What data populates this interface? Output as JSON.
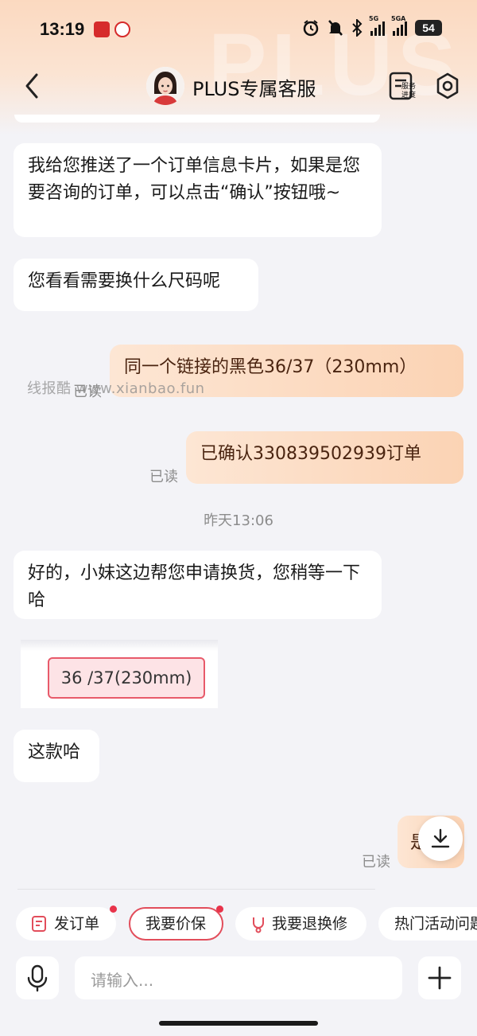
{
  "status_bar": {
    "time": "13:19",
    "signal_1_label": "5G",
    "signal_2_label": "5GA",
    "battery": "54"
  },
  "header": {
    "title": "PLUS专属客服",
    "progress_label": "服务进度",
    "watermark": "PLUS"
  },
  "messages": [
    {
      "from": "agent",
      "text": "我给您推送了一个订单信息卡片，如果是您要咨询的订单，可以点击“确认”按钮哦~"
    },
    {
      "from": "agent",
      "text": "您看看需要换什么尺码呢"
    },
    {
      "from": "user",
      "text": "同一个链接的黑色36/37（230mm）",
      "status": "已读"
    },
    {
      "from": "user",
      "text": "已确认330839502939订单",
      "status": "已读"
    },
    {
      "from": "agent",
      "text": "好的，小妹这边帮您申请换货，您稍等一下哈"
    },
    {
      "from": "agent",
      "type": "image",
      "image_text": "36 /37(230mm)"
    },
    {
      "from": "agent",
      "text": "这款哈"
    },
    {
      "from": "user",
      "text": "是",
      "status": "已读"
    }
  ],
  "timestamp": "昨天13:06",
  "watermark_text": "线报酷 www.xianbao.fun",
  "quick_actions": [
    {
      "label": "发订单",
      "icon": "order-icon",
      "has_dot": true
    },
    {
      "label": "我要价保",
      "active": true,
      "has_dot": true
    },
    {
      "label": "我要退换修",
      "icon": "return-icon"
    },
    {
      "label": "热门活动问题"
    }
  ],
  "input": {
    "placeholder": "请输入..."
  },
  "colors": {
    "accent": "#e24d5b",
    "user_bubble": "#fbd3b4",
    "background": "#f3f3f7",
    "unread_dot": "#e8334a"
  }
}
